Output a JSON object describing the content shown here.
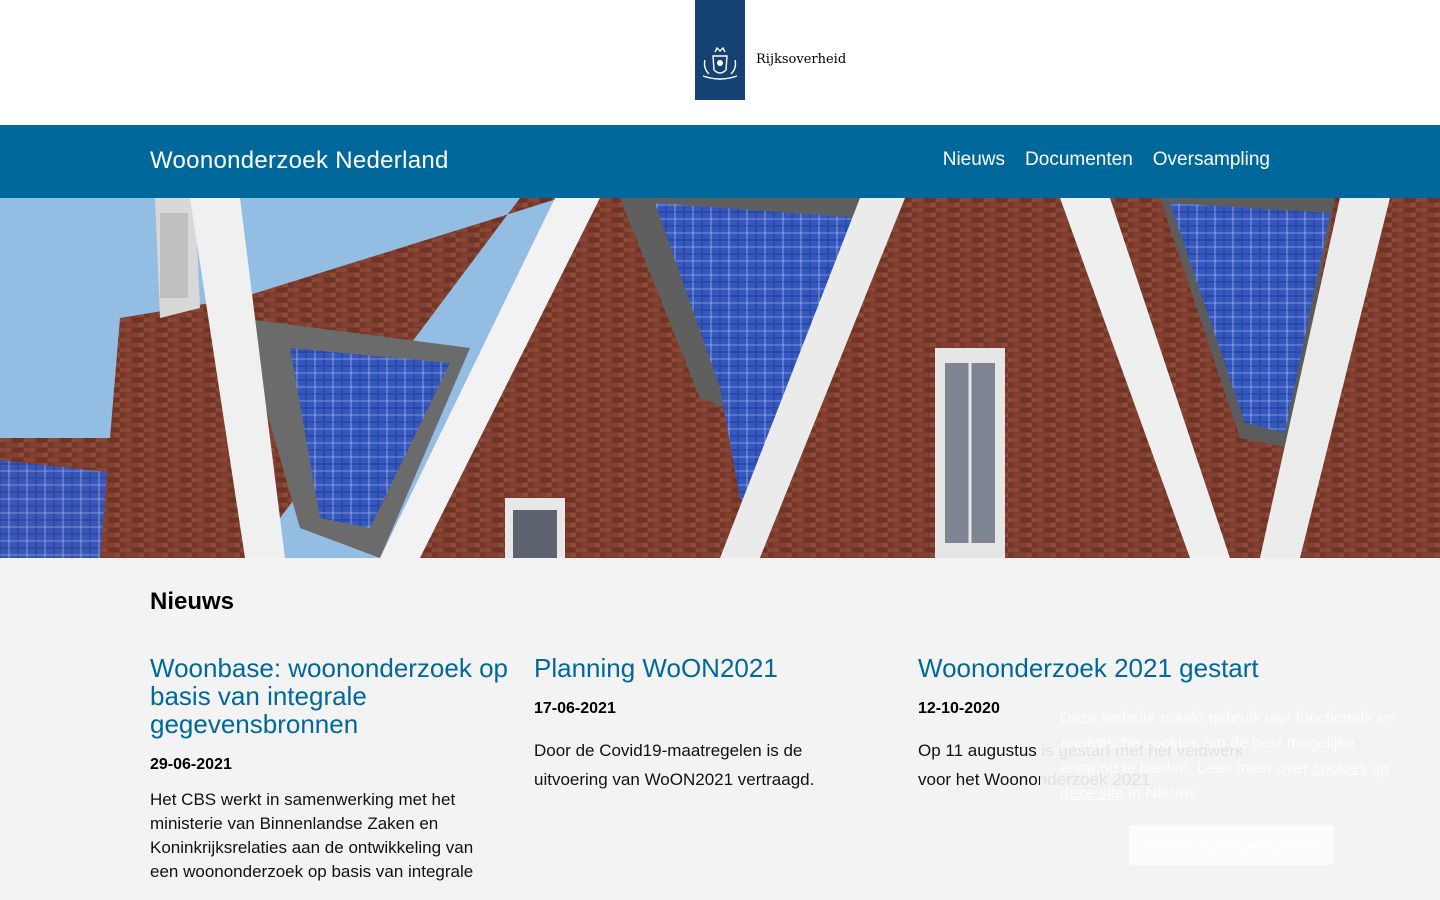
{
  "brand": {
    "logo_text": "Rijksoverheid",
    "color": "#154273"
  },
  "header": {
    "site_title": "Woononderzoek Nederland",
    "nav": [
      "Nieuws",
      "Documenten",
      "Oversampling"
    ],
    "color": "#01689b"
  },
  "news": {
    "title": "Nieuws",
    "items": [
      {
        "title": "Woonbase: woononderzoek op basis van integrale gegevensbronnen",
        "date": "29-06-2021",
        "text": "Het CBS werkt in samenwerking met het ministerie van Binnenlandse Zaken en Koninkrijksrelaties aan de ontwikkeling van een woononderzoek op basis van integrale"
      },
      {
        "title": "Planning WoON2021",
        "date": "17-06-2021",
        "text": "Door de Covid19-maatregelen is de uitvoering van WoON2021 vertraagd."
      },
      {
        "title": "Woononderzoek 2021 gestart",
        "date": "12-10-2020",
        "text": "Op 11 augustus is gestart met het veldwerk voor het Woononderzoek 2021."
      }
    ]
  },
  "cookie": {
    "message": "Deze website maakt gebruik van functionele en analytische cookies om de best mogelijke ervaring te bieden. Lees meer over",
    "link": "cookies op deze site",
    "suffix": "in Nieuws",
    "button": "Sluiten en niet meer tonen"
  }
}
